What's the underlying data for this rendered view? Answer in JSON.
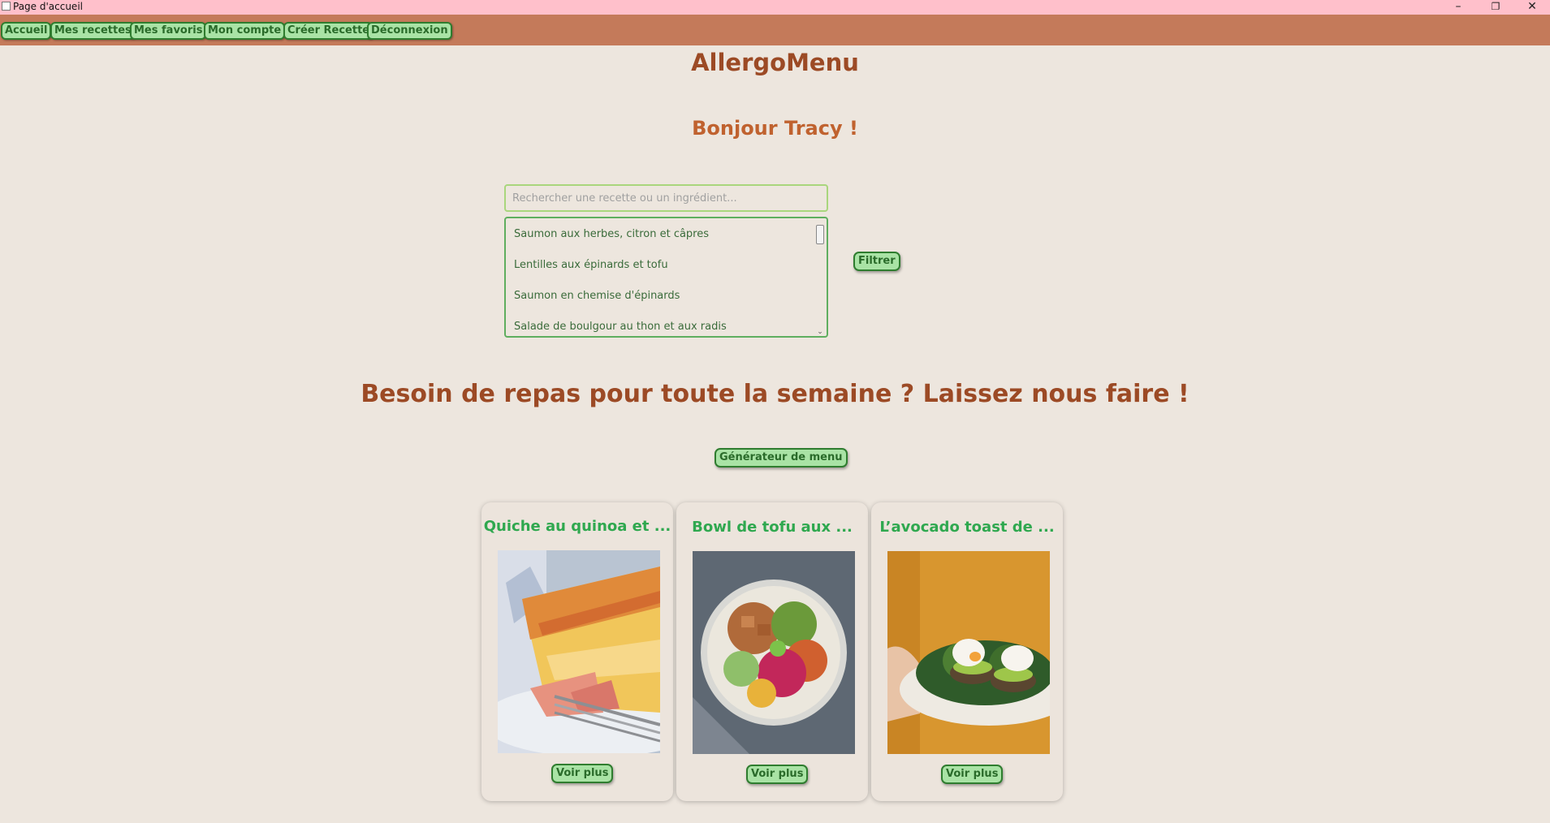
{
  "window": {
    "title": "Page d'accueil",
    "controls": [
      "–",
      "❐",
      "✕"
    ]
  },
  "nav": [
    "Accueil",
    "Mes recettes",
    "Mes favoris",
    "Mon compte",
    "Créer Recette",
    "Déconnexion"
  ],
  "header": {
    "app_title": "AllergoMenu",
    "greeting": "Bonjour Tracy !"
  },
  "search": {
    "placeholder": "Rechercher une recette ou un ingrédient...",
    "results": [
      "Saumon aux herbes, citron et câpres",
      "Lentilles aux épinards et tofu",
      "Saumon en chemise d'épinards",
      "Salade de boulgour au thon et aux radis"
    ],
    "filter_label": "Filtrer"
  },
  "promo": {
    "tagline": "Besoin de repas pour toute la semaine ? Laissez nous faire !",
    "generator_label": "Générateur de menu"
  },
  "cards": [
    {
      "title": "Quiche au quinoa et ...",
      "button": "Voir plus",
      "image": "quiche-photo"
    },
    {
      "title": "Bowl de tofu aux ...",
      "button": "Voir plus",
      "image": "tofu-bowl-photo"
    },
    {
      "title": "L’avocado toast de ...",
      "button": "Voir plus",
      "image": "avocado-toast-photo"
    }
  ],
  "colors": {
    "titlebar": "#ffc0cb",
    "menubar": "#c47a5a",
    "background": "#ede6de",
    "button_fill": "#a9e3a5",
    "button_border": "#2f7d2f",
    "heading": "#9c4a25",
    "greeting": "#c0622f",
    "card_title": "#2fa84f"
  }
}
